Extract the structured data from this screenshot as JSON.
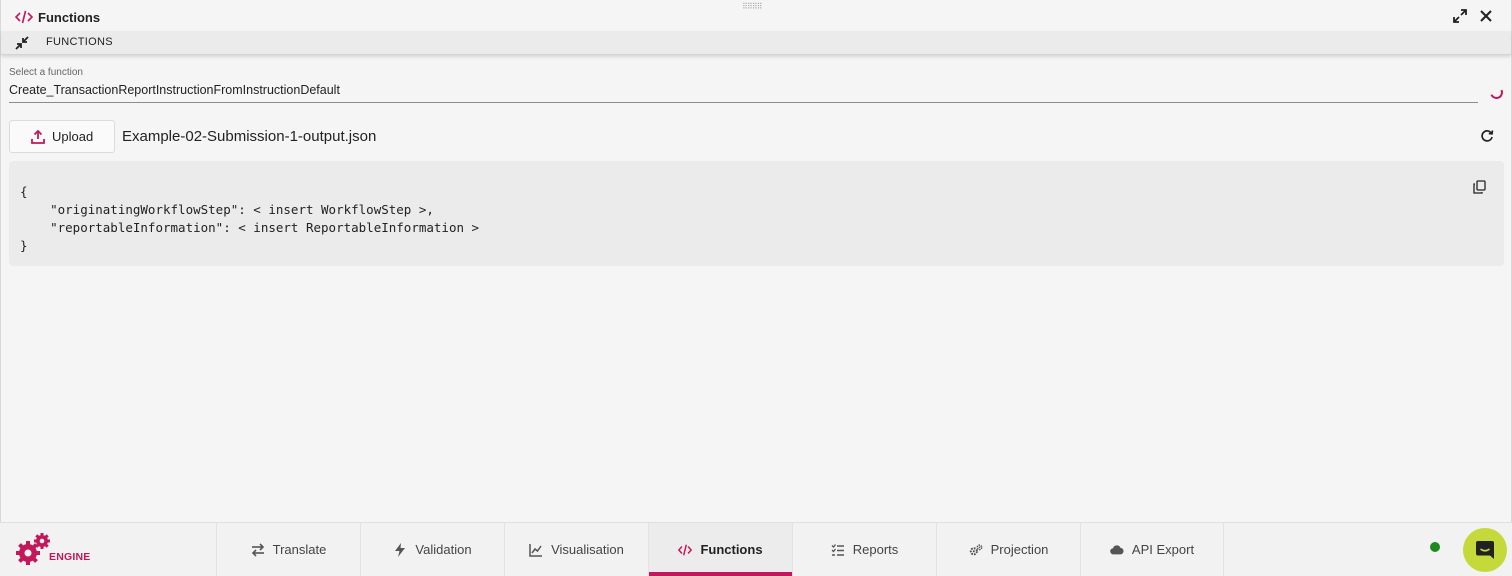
{
  "panel": {
    "title": "Functions",
    "subbar_label": "FUNCTIONS"
  },
  "select": {
    "label": "Select a function",
    "value": "Create_TransactionReportInstructionFromInstructionDefault"
  },
  "upload": {
    "button_label": "Upload",
    "file_name": "Example-02-Submission-1-output.json"
  },
  "code": {
    "lines": [
      "{",
      "    \"originatingWorkflowStep\": < insert WorkflowStep >,",
      "    \"reportableInformation\": < insert ReportableInformation >",
      "}"
    ]
  },
  "brand": {
    "name": "ENGINE",
    "accent_color": "#c2185b"
  },
  "tabs": [
    {
      "label": "Translate",
      "icon": "swap-arrows-icon",
      "active": false
    },
    {
      "label": "Validation",
      "icon": "lightning-icon",
      "active": false
    },
    {
      "label": "Visualisation",
      "icon": "line-chart-icon",
      "active": false
    },
    {
      "label": "Functions",
      "icon": "code-icon",
      "active": true
    },
    {
      "label": "Reports",
      "icon": "checklist-icon",
      "active": false
    },
    {
      "label": "Projection",
      "icon": "gears-icon",
      "active": false
    },
    {
      "label": "API Export",
      "icon": "cloud-icon",
      "active": false
    }
  ],
  "status": {
    "color": "#1e8a1e"
  }
}
